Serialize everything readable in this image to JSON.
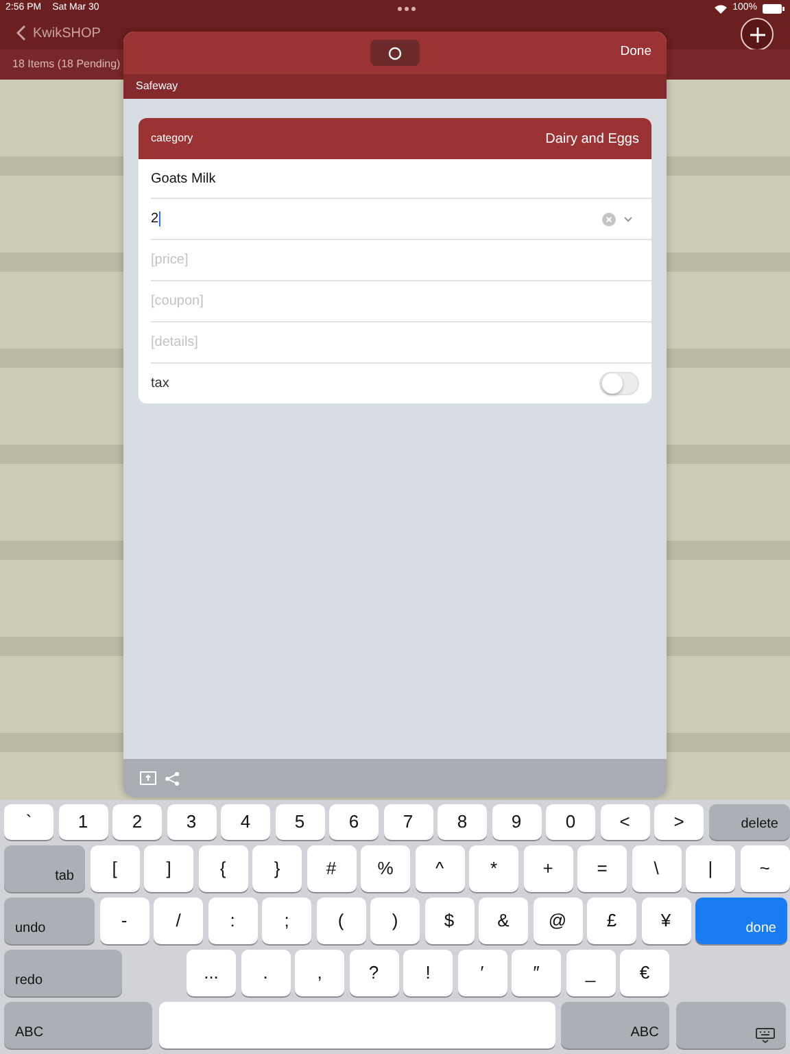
{
  "status_bar": {
    "time": "2:56 PM",
    "date": "Sat Mar 30",
    "battery_text": "100%"
  },
  "nav": {
    "back_label": "KwikSHOP",
    "subtitle": "18 Items (18 Pending)"
  },
  "modal": {
    "done": "Done",
    "store": "Safeway",
    "category_label": "category",
    "category_value": "Dairy and Eggs",
    "name": "Goats Milk",
    "quantity": "2",
    "fields": [
      {
        "placeholder": "[price]"
      },
      {
        "placeholder": "[coupon]"
      },
      {
        "placeholder": "[details]"
      }
    ],
    "tax": {
      "label": "tax",
      "on": false
    }
  },
  "keyboard": {
    "rows": [
      {
        "keys": [
          {
            "label": "`",
            "kind": "char"
          },
          {
            "label": "1",
            "kind": "char"
          },
          {
            "label": "2",
            "kind": "char"
          },
          {
            "label": "3",
            "kind": "char"
          },
          {
            "label": "4",
            "kind": "char"
          },
          {
            "label": "5",
            "kind": "char"
          },
          {
            "label": "6",
            "kind": "char"
          },
          {
            "label": "7",
            "kind": "char"
          },
          {
            "label": "8",
            "kind": "char"
          },
          {
            "label": "9",
            "kind": "char"
          },
          {
            "label": "0",
            "kind": "char"
          },
          {
            "label": "<",
            "kind": "char"
          },
          {
            "label": ">",
            "kind": "char"
          },
          {
            "label": "delete",
            "kind": "fn"
          }
        ]
      },
      {
        "keys": [
          {
            "label": "tab",
            "kind": "fn"
          },
          {
            "label": "[",
            "kind": "char"
          },
          {
            "label": "]",
            "kind": "char"
          },
          {
            "label": "{",
            "kind": "char"
          },
          {
            "label": "}",
            "kind": "char"
          },
          {
            "label": "#",
            "kind": "char"
          },
          {
            "label": "%",
            "kind": "char"
          },
          {
            "label": "^",
            "kind": "char"
          },
          {
            "label": "*",
            "kind": "char"
          },
          {
            "label": "+",
            "kind": "char"
          },
          {
            "label": "=",
            "kind": "char"
          },
          {
            "label": "\\",
            "kind": "char"
          },
          {
            "label": "|",
            "kind": "char"
          },
          {
            "label": "~",
            "kind": "char"
          }
        ]
      },
      {
        "keys": [
          {
            "label": "undo",
            "kind": "dim"
          },
          {
            "label": "-",
            "kind": "char"
          },
          {
            "label": "/",
            "kind": "char"
          },
          {
            "label": ":",
            "kind": "char"
          },
          {
            "label": ";",
            "kind": "char"
          },
          {
            "label": "(",
            "kind": "char"
          },
          {
            "label": ")",
            "kind": "char"
          },
          {
            "label": "$",
            "kind": "char"
          },
          {
            "label": "&",
            "kind": "char"
          },
          {
            "label": "@",
            "kind": "char"
          },
          {
            "label": "£",
            "kind": "char"
          },
          {
            "label": "¥",
            "kind": "char"
          },
          {
            "label": "done",
            "kind": "primary"
          }
        ]
      },
      {
        "keys": [
          {
            "label": "redo",
            "kind": "dim"
          },
          {
            "label": "...",
            "kind": "char"
          },
          {
            "label": ".",
            "kind": "char"
          },
          {
            "label": ",",
            "kind": "char"
          },
          {
            "label": "?",
            "kind": "char"
          },
          {
            "label": "!",
            "kind": "char"
          },
          {
            "label": "′",
            "kind": "char"
          },
          {
            "label": "″",
            "kind": "char"
          },
          {
            "label": "_",
            "kind": "char"
          },
          {
            "label": "€",
            "kind": "char"
          }
        ]
      },
      {
        "keys": [
          {
            "label": "ABC",
            "kind": "fn-left"
          },
          {
            "kind": "space"
          },
          {
            "label": "ABC",
            "kind": "fn"
          },
          {
            "kind": "hide"
          }
        ]
      }
    ]
  }
}
